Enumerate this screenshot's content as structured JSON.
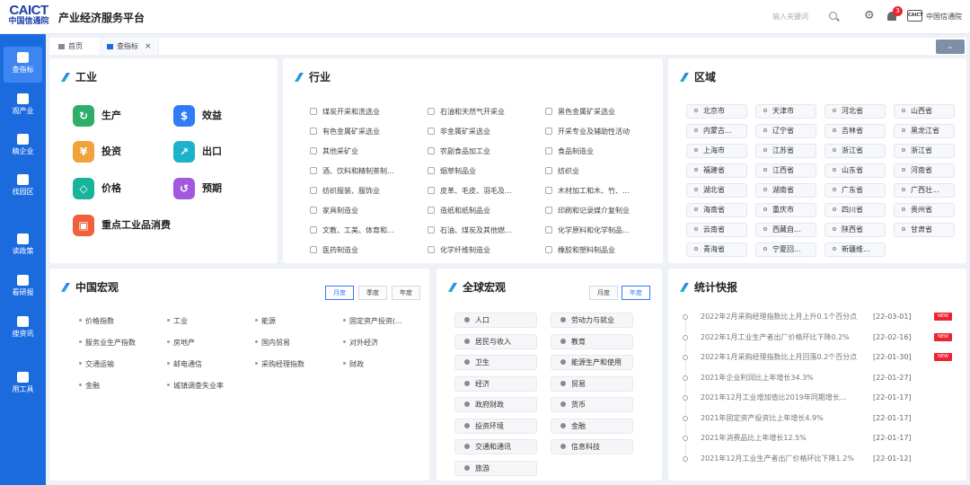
{
  "header": {
    "logo_main": "CAICT",
    "logo_sub": "中国信通院",
    "title": "产业经济服务平台",
    "search_placeholder": "输入关键词",
    "notification_count": "3",
    "user_logo": "CAICT",
    "user_name": "中国信通院"
  },
  "sidebar": {
    "items": [
      {
        "label": "查指标",
        "active": true
      },
      {
        "label": "观产业"
      },
      {
        "label": "精企业"
      },
      {
        "label": "找园区"
      },
      {
        "label": "读政策"
      },
      {
        "label": "看研报"
      },
      {
        "label": "搜资讯"
      },
      {
        "label": "用工具"
      }
    ]
  },
  "tabs": [
    {
      "label": "首页",
      "icon": "home-icon"
    },
    {
      "label": "查指标",
      "icon": "chart-icon",
      "active": true,
      "close": "×"
    }
  ],
  "collapse_label": "⌄",
  "industry": {
    "title": "工业",
    "items": [
      {
        "label": "生产",
        "color": "#2fae6a",
        "icon": "production-icon"
      },
      {
        "label": "效益",
        "color": "#2f7cf6",
        "icon": "money-bag-icon"
      },
      {
        "label": "投资",
        "color": "#f1a23a",
        "icon": "investment-icon"
      },
      {
        "label": "出口",
        "color": "#1cb2c9",
        "icon": "export-icon"
      },
      {
        "label": "价格",
        "color": "#17b39a",
        "icon": "price-tag-icon"
      },
      {
        "label": "预期",
        "color": "#a259e0",
        "icon": "forecast-icon"
      },
      {
        "label": "重点工业品消费",
        "color": "#f0603a",
        "icon": "consumption-icon"
      }
    ]
  },
  "sector": {
    "title": "行业",
    "items": [
      "煤炭开采和洗选业",
      "石油和天然气开采业",
      "黑色金属矿采选业",
      "有色金属矿采选业",
      "非金属矿采选业",
      "开采专业及辅助性活动",
      "其他采矿业",
      "农副食品加工业",
      "食品制造业",
      "酒、饮料和精制茶制...",
      "烟草制品业",
      "纺织业",
      "纺织服装、服饰业",
      "皮革、毛皮、羽毛及...",
      "木材加工和木、竹、...",
      "家具制造业",
      "造纸和纸制品业",
      "印刷和记录媒介复制业",
      "文教、工美、体育和...",
      "石油、煤炭及其他燃...",
      "化学原料和化学制品...",
      "医药制造业",
      "化学纤维制造业",
      "橡胶和塑料制品业"
    ]
  },
  "region": {
    "title": "区域",
    "items": [
      "北京市",
      "天津市",
      "河北省",
      "山西省",
      "内蒙古...",
      "辽宁省",
      "吉林省",
      "黑龙江省",
      "上海市",
      "江苏省",
      "浙江省",
      "浙江省",
      "福建省",
      "江西省",
      "山东省",
      "河南省",
      "湖北省",
      "湖南省",
      "广东省",
      "广西壮...",
      "海南省",
      "重庆市",
      "四川省",
      "贵州省",
      "云南省",
      "西藏自...",
      "陕西省",
      "甘肃省",
      "青海省",
      "宁夏回...",
      "新疆维..."
    ]
  },
  "china_macro": {
    "title": "中国宏观",
    "period_tabs": [
      {
        "label": "月度",
        "active": true
      },
      {
        "label": "季度"
      },
      {
        "label": "年度"
      }
    ],
    "items": [
      "价格指数",
      "工业",
      "能源",
      "固定资产投资(...",
      "服务业生产指数",
      "房地产",
      "国内贸易",
      "对外经济",
      "交通运输",
      "邮电通信",
      "采购经理指数",
      "财政",
      "金融",
      "城镇调查失业率"
    ]
  },
  "global_macro": {
    "title": "全球宏观",
    "period_tabs": [
      {
        "label": "月度"
      },
      {
        "label": "年度",
        "active": true
      }
    ],
    "items": [
      "人口",
      "劳动力与就业",
      "居民与收入",
      "教育",
      "卫生",
      "能源生产和使用",
      "经济",
      "贸易",
      "政府财政",
      "货币",
      "投资环境",
      "金融",
      "交通和通讯",
      "信息科技",
      "旅游"
    ]
  },
  "bulletin": {
    "title": "统计快报",
    "items": [
      {
        "text": "2022年2月采购经理指数比上月上升0.1个百分点",
        "date": "[22-03-01]",
        "badge": "NEW"
      },
      {
        "text": "2022年1月工业生产者出厂价格环比下降0.2%",
        "date": "[22-02-16]",
        "badge": "NEW"
      },
      {
        "text": "2022年1月采购经理指数比上月回落0.2个百分点",
        "date": "[22-01-30]",
        "badge": "NEW"
      },
      {
        "text": "2021年企业利润比上年增长34.3%",
        "date": "[22-01-27]"
      },
      {
        "text": "2021年12月工业增加值比2019年同期增长...",
        "date": "[22-01-17]"
      },
      {
        "text": "2021年固定资产投资比上年增长4.9%",
        "date": "[22-01-17]"
      },
      {
        "text": "2021年消费品比上年增长12.5%",
        "date": "[22-01-17]"
      },
      {
        "text": "2021年12月工业生产者出厂价格环比下降1.2%",
        "date": "[22-01-12]"
      }
    ]
  }
}
